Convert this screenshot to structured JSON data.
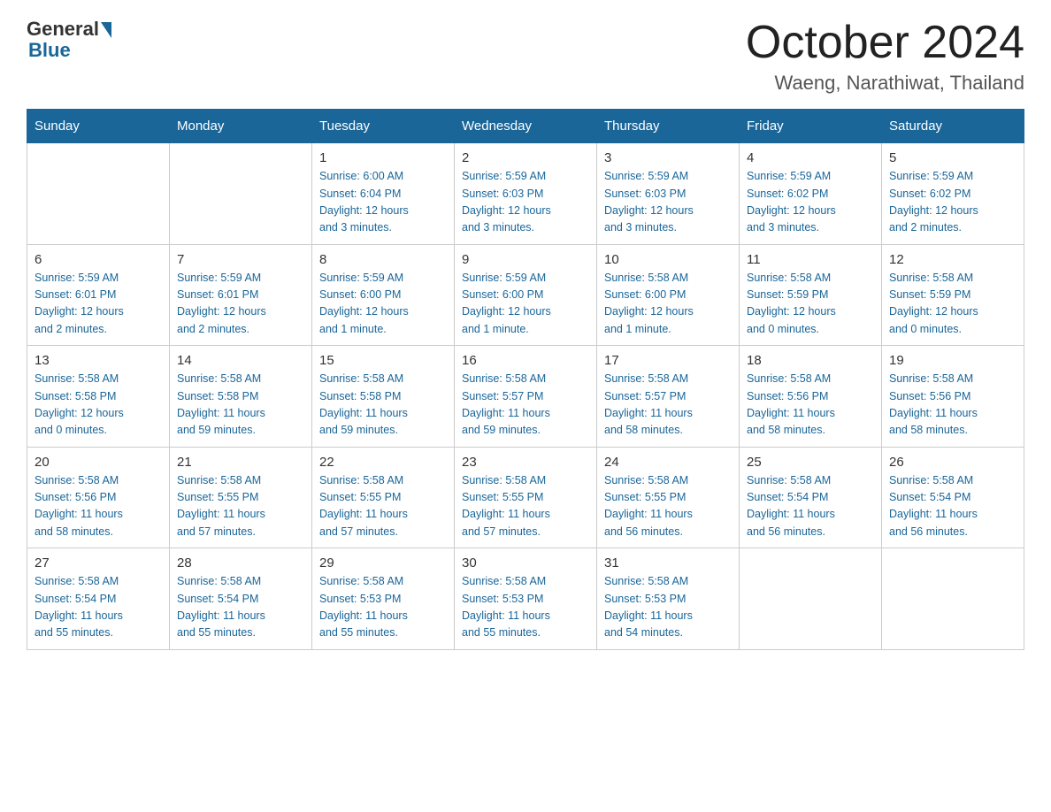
{
  "header": {
    "logo_general": "General",
    "logo_blue": "Blue",
    "main_title": "October 2024",
    "sub_title": "Waeng, Narathiwat, Thailand"
  },
  "columns": [
    "Sunday",
    "Monday",
    "Tuesday",
    "Wednesday",
    "Thursday",
    "Friday",
    "Saturday"
  ],
  "weeks": [
    [
      {
        "day": "",
        "detail": ""
      },
      {
        "day": "",
        "detail": ""
      },
      {
        "day": "1",
        "detail": "Sunrise: 6:00 AM\nSunset: 6:04 PM\nDaylight: 12 hours\nand 3 minutes."
      },
      {
        "day": "2",
        "detail": "Sunrise: 5:59 AM\nSunset: 6:03 PM\nDaylight: 12 hours\nand 3 minutes."
      },
      {
        "day": "3",
        "detail": "Sunrise: 5:59 AM\nSunset: 6:03 PM\nDaylight: 12 hours\nand 3 minutes."
      },
      {
        "day": "4",
        "detail": "Sunrise: 5:59 AM\nSunset: 6:02 PM\nDaylight: 12 hours\nand 3 minutes."
      },
      {
        "day": "5",
        "detail": "Sunrise: 5:59 AM\nSunset: 6:02 PM\nDaylight: 12 hours\nand 2 minutes."
      }
    ],
    [
      {
        "day": "6",
        "detail": "Sunrise: 5:59 AM\nSunset: 6:01 PM\nDaylight: 12 hours\nand 2 minutes."
      },
      {
        "day": "7",
        "detail": "Sunrise: 5:59 AM\nSunset: 6:01 PM\nDaylight: 12 hours\nand 2 minutes."
      },
      {
        "day": "8",
        "detail": "Sunrise: 5:59 AM\nSunset: 6:00 PM\nDaylight: 12 hours\nand 1 minute."
      },
      {
        "day": "9",
        "detail": "Sunrise: 5:59 AM\nSunset: 6:00 PM\nDaylight: 12 hours\nand 1 minute."
      },
      {
        "day": "10",
        "detail": "Sunrise: 5:58 AM\nSunset: 6:00 PM\nDaylight: 12 hours\nand 1 minute."
      },
      {
        "day": "11",
        "detail": "Sunrise: 5:58 AM\nSunset: 5:59 PM\nDaylight: 12 hours\nand 0 minutes."
      },
      {
        "day": "12",
        "detail": "Sunrise: 5:58 AM\nSunset: 5:59 PM\nDaylight: 12 hours\nand 0 minutes."
      }
    ],
    [
      {
        "day": "13",
        "detail": "Sunrise: 5:58 AM\nSunset: 5:58 PM\nDaylight: 12 hours\nand 0 minutes."
      },
      {
        "day": "14",
        "detail": "Sunrise: 5:58 AM\nSunset: 5:58 PM\nDaylight: 11 hours\nand 59 minutes."
      },
      {
        "day": "15",
        "detail": "Sunrise: 5:58 AM\nSunset: 5:58 PM\nDaylight: 11 hours\nand 59 minutes."
      },
      {
        "day": "16",
        "detail": "Sunrise: 5:58 AM\nSunset: 5:57 PM\nDaylight: 11 hours\nand 59 minutes."
      },
      {
        "day": "17",
        "detail": "Sunrise: 5:58 AM\nSunset: 5:57 PM\nDaylight: 11 hours\nand 58 minutes."
      },
      {
        "day": "18",
        "detail": "Sunrise: 5:58 AM\nSunset: 5:56 PM\nDaylight: 11 hours\nand 58 minutes."
      },
      {
        "day": "19",
        "detail": "Sunrise: 5:58 AM\nSunset: 5:56 PM\nDaylight: 11 hours\nand 58 minutes."
      }
    ],
    [
      {
        "day": "20",
        "detail": "Sunrise: 5:58 AM\nSunset: 5:56 PM\nDaylight: 11 hours\nand 58 minutes."
      },
      {
        "day": "21",
        "detail": "Sunrise: 5:58 AM\nSunset: 5:55 PM\nDaylight: 11 hours\nand 57 minutes."
      },
      {
        "day": "22",
        "detail": "Sunrise: 5:58 AM\nSunset: 5:55 PM\nDaylight: 11 hours\nand 57 minutes."
      },
      {
        "day": "23",
        "detail": "Sunrise: 5:58 AM\nSunset: 5:55 PM\nDaylight: 11 hours\nand 57 minutes."
      },
      {
        "day": "24",
        "detail": "Sunrise: 5:58 AM\nSunset: 5:55 PM\nDaylight: 11 hours\nand 56 minutes."
      },
      {
        "day": "25",
        "detail": "Sunrise: 5:58 AM\nSunset: 5:54 PM\nDaylight: 11 hours\nand 56 minutes."
      },
      {
        "day": "26",
        "detail": "Sunrise: 5:58 AM\nSunset: 5:54 PM\nDaylight: 11 hours\nand 56 minutes."
      }
    ],
    [
      {
        "day": "27",
        "detail": "Sunrise: 5:58 AM\nSunset: 5:54 PM\nDaylight: 11 hours\nand 55 minutes."
      },
      {
        "day": "28",
        "detail": "Sunrise: 5:58 AM\nSunset: 5:54 PM\nDaylight: 11 hours\nand 55 minutes."
      },
      {
        "day": "29",
        "detail": "Sunrise: 5:58 AM\nSunset: 5:53 PM\nDaylight: 11 hours\nand 55 minutes."
      },
      {
        "day": "30",
        "detail": "Sunrise: 5:58 AM\nSunset: 5:53 PM\nDaylight: 11 hours\nand 55 minutes."
      },
      {
        "day": "31",
        "detail": "Sunrise: 5:58 AM\nSunset: 5:53 PM\nDaylight: 11 hours\nand 54 minutes."
      },
      {
        "day": "",
        "detail": ""
      },
      {
        "day": "",
        "detail": ""
      }
    ]
  ]
}
